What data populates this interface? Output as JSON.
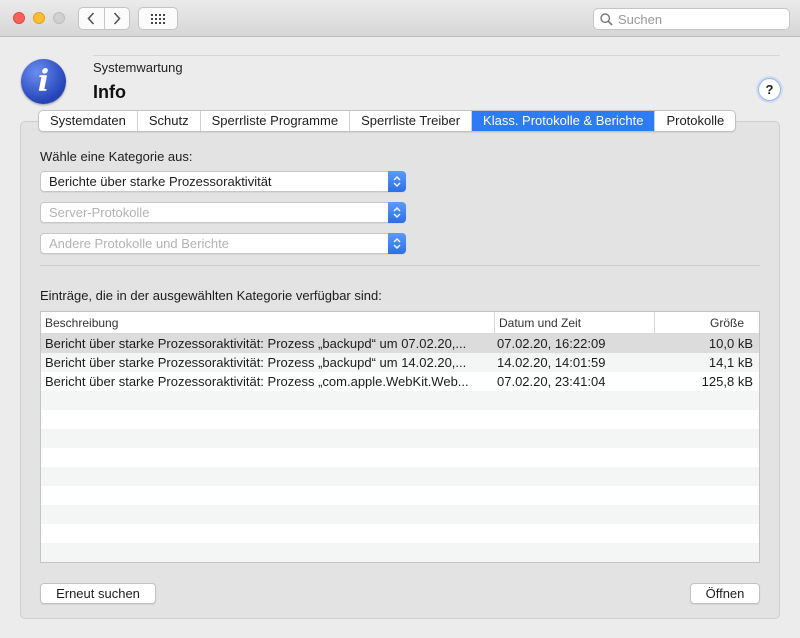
{
  "window": {
    "search": {
      "placeholder": "Suchen",
      "value": ""
    }
  },
  "header": {
    "subtitle": "Systemwartung",
    "title": "Info",
    "help_label": "?",
    "app_icon_glyph": "i"
  },
  "tabs": [
    {
      "label": "Systemdaten",
      "active": false
    },
    {
      "label": "Schutz",
      "active": false
    },
    {
      "label": "Sperrliste Programme",
      "active": false
    },
    {
      "label": "Sperrliste Treiber",
      "active": false
    },
    {
      "label": "Klass. Protokolle & Berichte",
      "active": true
    },
    {
      "label": "Protokolle",
      "active": false
    }
  ],
  "category": {
    "label": "Wähle eine Kategorie aus:",
    "popups": [
      {
        "value": "Berichte über starke Prozessoraktivität",
        "enabled": true
      },
      {
        "value": "Server-Protokolle",
        "enabled": false
      },
      {
        "value": "Andere Protokolle und Berichte",
        "enabled": false
      }
    ]
  },
  "entries": {
    "label": "Einträge, die in der ausgewählten Kategorie verfügbar sind:",
    "columns": [
      "Beschreibung",
      "Datum und Zeit",
      "Größe"
    ],
    "rows": [
      {
        "description": "Bericht über starke Prozessoraktivität: Prozess „backupd“ um 07.02.20,...",
        "datetime": "07.02.20, 16:22:09",
        "size": "10,0 kB",
        "selected": true
      },
      {
        "description": "Bericht über starke Prozessoraktivität: Prozess „backupd“ um 14.02.20,...",
        "datetime": "14.02.20, 14:01:59",
        "size": "14,1 kB",
        "selected": false
      },
      {
        "description": "Bericht über starke Prozessoraktivität: Prozess „com.apple.WebKit.Web...",
        "datetime": "07.02.20, 23:41:04",
        "size": "125,8 kB",
        "selected": false
      }
    ]
  },
  "buttons": {
    "rescan": "Erneut suchen",
    "open": "Öffnen"
  },
  "colors": {
    "accent": "#2e7bf6",
    "selected_row": "#dcdcdc"
  },
  "icons": [
    "chevron-left-icon",
    "chevron-right-icon",
    "grid-icon",
    "search-icon",
    "info-icon",
    "popup-stepper-icon"
  ]
}
